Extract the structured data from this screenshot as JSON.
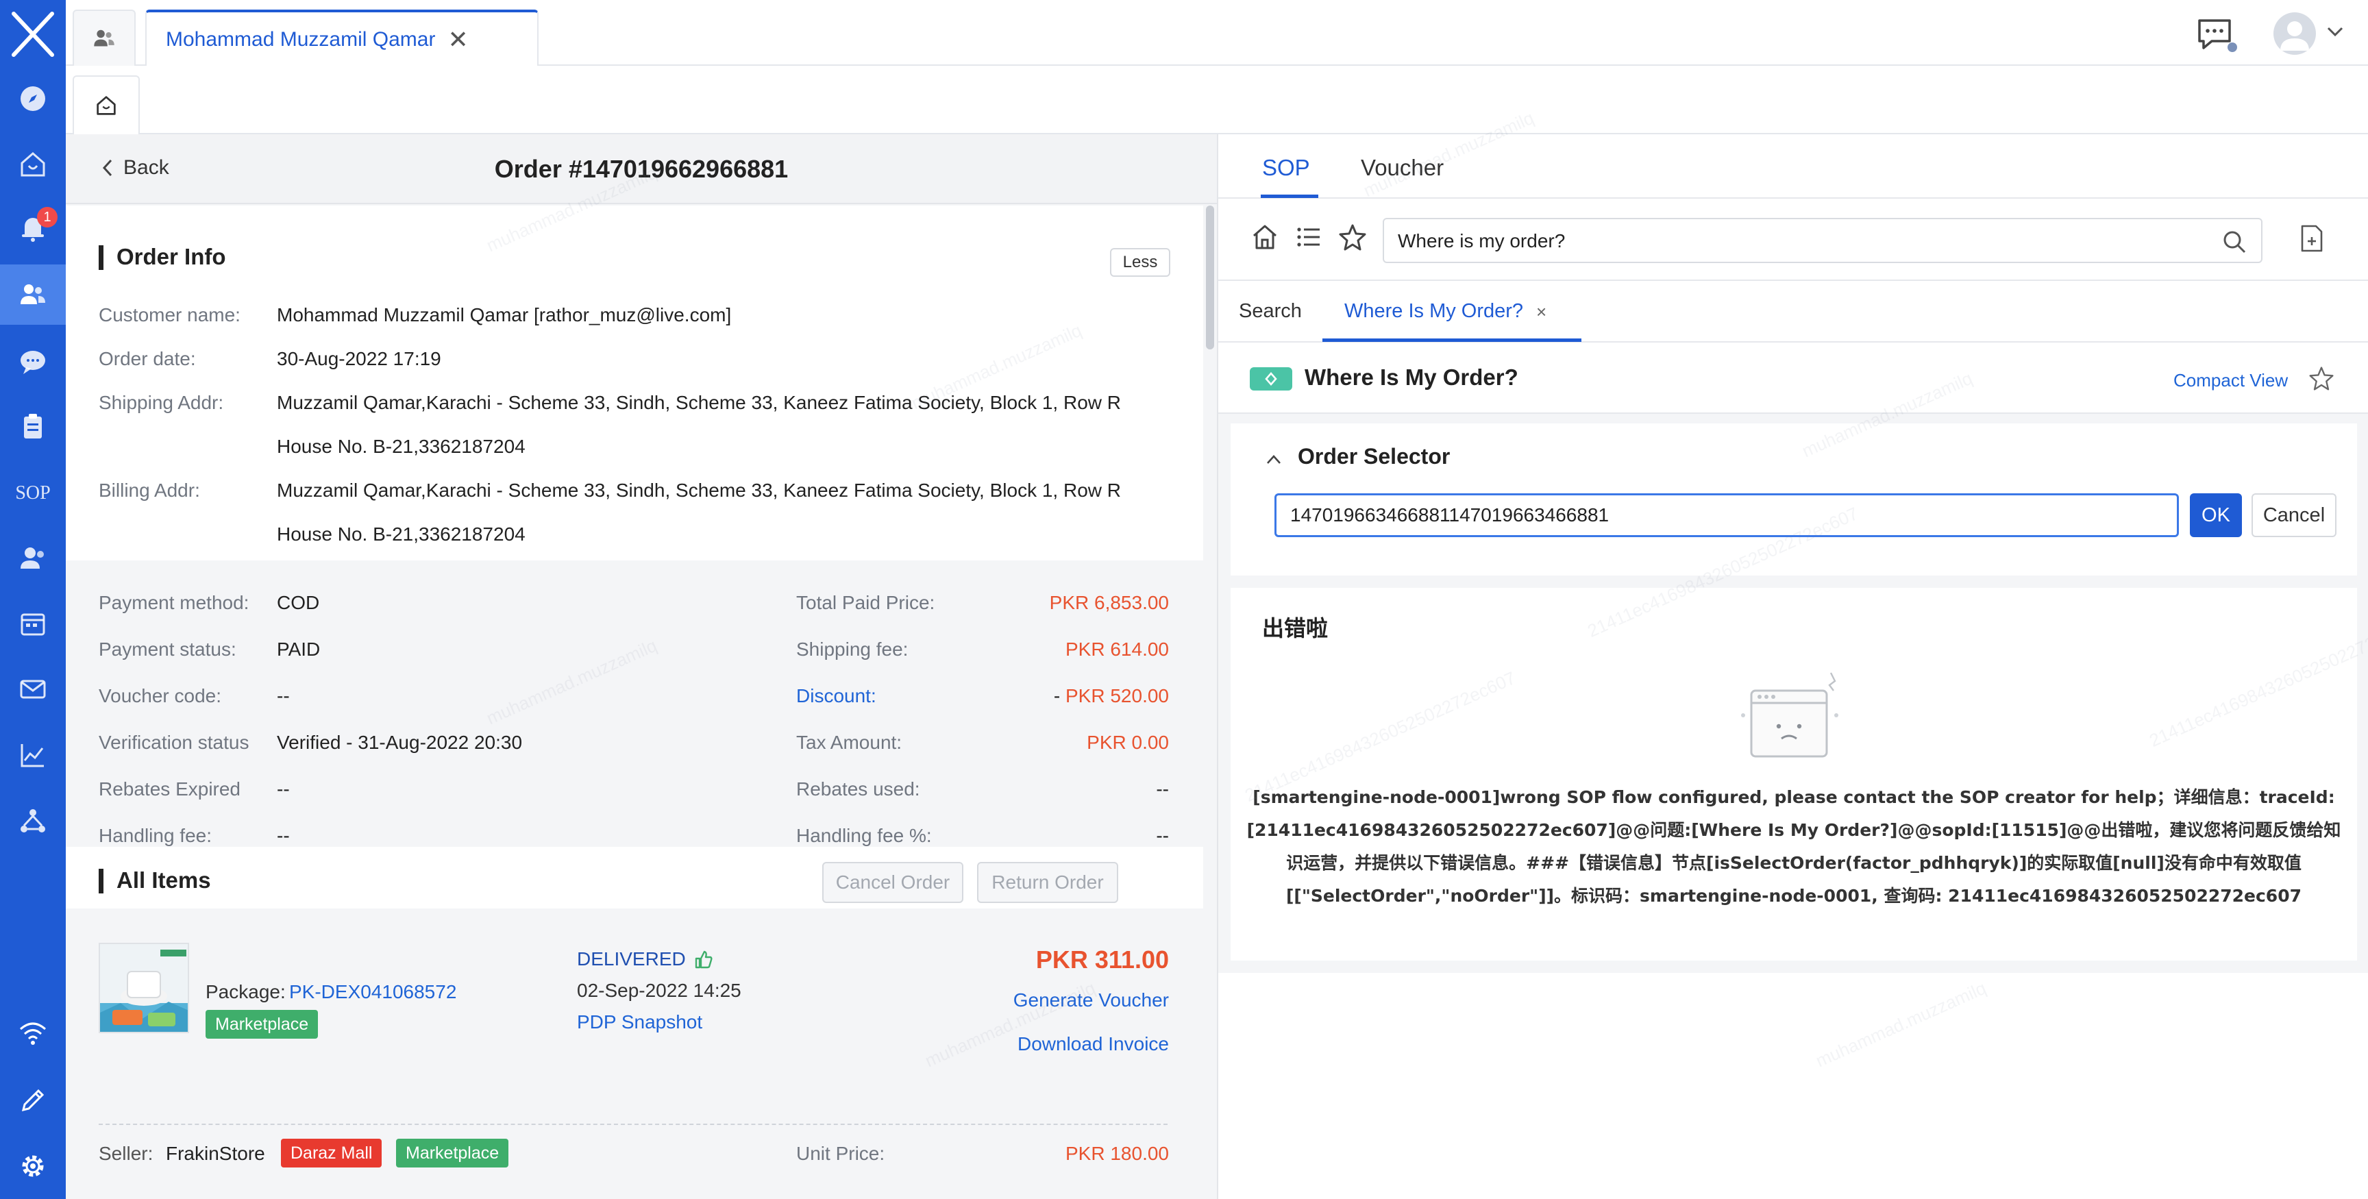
{
  "rail": {
    "icons": [
      "logo-x-icon",
      "compass-icon",
      "home-icon",
      "bell-icon",
      "people-icon",
      "chat-icon",
      "clipboard-icon",
      "sop-icon",
      "person-icon",
      "calendar-icon",
      "mail-icon",
      "chart-icon",
      "network-icon",
      "wifi-icon",
      "pencil-icon",
      "gear-icon"
    ],
    "notification_count": "1",
    "sop_label": "SOP"
  },
  "topbar": {
    "customer_tab": "Mohammad Muzzamil Qamar",
    "close_glyph": "✕"
  },
  "order": {
    "back_label": "Back",
    "title": "Order #147019662966881",
    "info_title": "Order Info",
    "less_label": "Less",
    "customer_name_label": "Customer name:",
    "customer_name": "Mohammad Muzzamil Qamar [rathor_muz@live.com]",
    "order_date_label": "Order date:",
    "order_date": "30-Aug-2022 17:19",
    "shipping_addr_label": "Shipping Addr:",
    "shipping_addr_line1": "Muzzamil Qamar,Karachi - Scheme 33, Sindh, Scheme 33, Kaneez Fatima Society, Block 1, Row R",
    "shipping_addr_line2": "House No. B-21,3362187204",
    "billing_addr_label": "Billing Addr:",
    "billing_addr_line1": "Muzzamil Qamar,Karachi - Scheme 33, Sindh, Scheme 33, Kaneez Fatima Society, Block 1, Row R",
    "billing_addr_line2": "House No. B-21,3362187204"
  },
  "payment": {
    "left": [
      {
        "label": "Payment method:",
        "value": "COD"
      },
      {
        "label": "Payment status:",
        "value": "PAID"
      },
      {
        "label": "Voucher code:",
        "value": "--"
      },
      {
        "label": "Verification status",
        "value": "Verified - 31-Aug-2022 20:30"
      },
      {
        "label": "Rebates Expired",
        "value": "--"
      },
      {
        "label": "Handling fee:",
        "value": "--"
      }
    ],
    "right": [
      {
        "label": "Total Paid Price:",
        "value": "PKR 6,853.00"
      },
      {
        "label": "Shipping fee:",
        "value": "PKR 614.00"
      },
      {
        "label": "Discount:",
        "prefix": "- ",
        "value": "PKR 520.00"
      },
      {
        "label": "Tax Amount:",
        "value": "PKR 0.00"
      },
      {
        "label": "Rebates used:",
        "value": "--"
      },
      {
        "label": "Handling fee %:",
        "value": "--"
      }
    ]
  },
  "items": {
    "title": "All Items",
    "cancel_order": "Cancel Order",
    "return_order": "Return Order",
    "package_label": "Package:",
    "package_id": "PK-DEX041068572",
    "marketplace_tag": "Marketplace",
    "status": "DELIVERED",
    "status_date": "02-Sep-2022 14:25",
    "pdp_snapshot": "PDP Snapshot",
    "price": "PKR 311.00",
    "generate_voucher": "Generate Voucher",
    "download_invoice": "Download Invoice",
    "seller_label": "Seller:",
    "seller_name": "FrakinStore",
    "daraz_mall_tag": "Daraz Mall",
    "unit_price_label": "Unit Price:",
    "unit_price": "PKR 180.00"
  },
  "sop": {
    "tabs": [
      "SOP",
      "Voucher"
    ],
    "search_value": "Where is my order?",
    "subtabs": [
      "Search",
      "Where Is My Order?"
    ],
    "subtab_close": "×",
    "page_title": "Where Is My Order?",
    "compact_view": "Compact View",
    "selector_title": "Order Selector",
    "order_input_value": "147019663466881147019663466881",
    "ok_label": "OK",
    "cancel_label": "Cancel",
    "error_title": "出错啦",
    "error_message": "[smartengine-node-0001]wrong SOP flow configured, please contact the SOP creator for help；详细信息：traceId:[21411ec416984326052502272ec607]@@问题:[Where Is My Order?]@@sopId:[11515]@@出错啦，建议您将问题反馈给知识运营，并提供以下错误信息。###【错误信息】节点[isSelectOrder(factor_pdhhqryk)]的实际取值[null]没有命中有效取值[[\"SelectOrder\",\"noOrder\"]]。标识码：smartengine-node-0001, 查询码: 21411ec416984326052502272ec607"
  },
  "watermark": {
    "user": "muhammad.muzzamilq",
    "trace": "21411ec416984326052502272ec607"
  },
  "colors": {
    "brand": "#1f5bd4",
    "price": "#e8532f",
    "tag_green": "#3fae6b",
    "tag_red": "#e83a2f",
    "sop_badge": "#4bc4a6"
  }
}
